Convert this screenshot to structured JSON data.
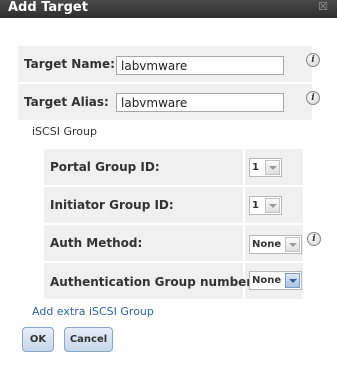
{
  "dialog": {
    "title": "Add Target",
    "close_glyph": "☒"
  },
  "fields": {
    "target_name_label": "Target Name:",
    "target_name_value": "labvmware",
    "target_alias_label": "Target Alias:",
    "target_alias_value": "labvmware"
  },
  "iscsi_group": {
    "heading": "iSCSI Group",
    "portal_group_label": "Portal Group ID:",
    "portal_group_value": "1",
    "initiator_group_label": "Initiator Group ID:",
    "initiator_group_value": "1",
    "auth_method_label": "Auth Method:",
    "auth_method_value": "None",
    "auth_group_label": "Authentication Group number:",
    "auth_group_value": "None"
  },
  "info_glyph": "i",
  "add_extra_link": "Add extra iSCSI Group",
  "buttons": {
    "ok": "OK",
    "cancel": "Cancel"
  },
  "colors": {
    "titlebar": "#3a3a3a",
    "link": "#2e64a8",
    "button_border": "#8aa6c8"
  }
}
